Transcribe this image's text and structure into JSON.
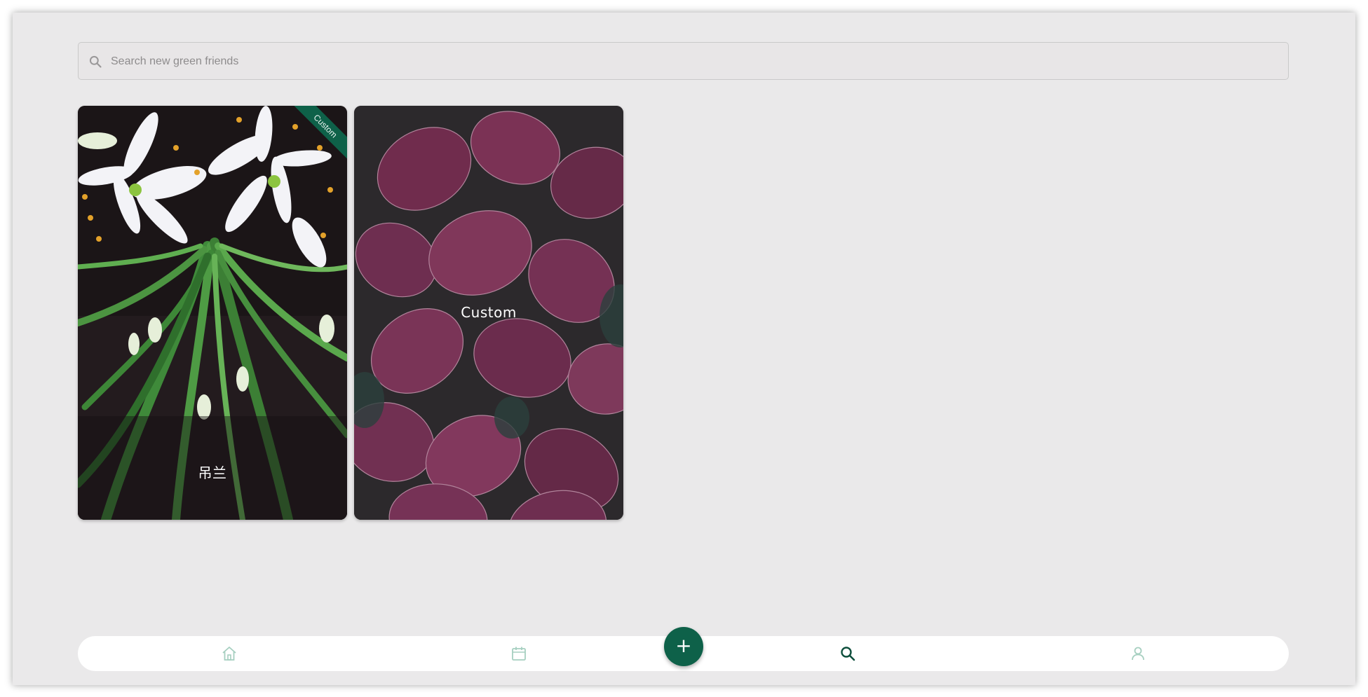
{
  "search": {
    "placeholder": "Search new green friends",
    "icon": "search-icon"
  },
  "cards": [
    {
      "title": "吊兰",
      "badge": "Custom",
      "image": "spider-plant-photo"
    },
    {
      "title": "Custom",
      "image": "fittonia-leaves-photo"
    }
  ],
  "fab": {
    "label": "+",
    "icon": "plus-icon"
  },
  "nav": {
    "items": [
      {
        "icon": "home-icon",
        "active": false
      },
      {
        "icon": "calendar-icon",
        "active": false
      },
      {
        "icon": "search-icon",
        "active": true
      },
      {
        "icon": "profile-icon",
        "active": false
      }
    ]
  },
  "colors": {
    "background": "#eae9ea",
    "accent": "#0e6149",
    "nav_inactive": "#a6cfc0",
    "nav_active": "#0e4f3c"
  }
}
